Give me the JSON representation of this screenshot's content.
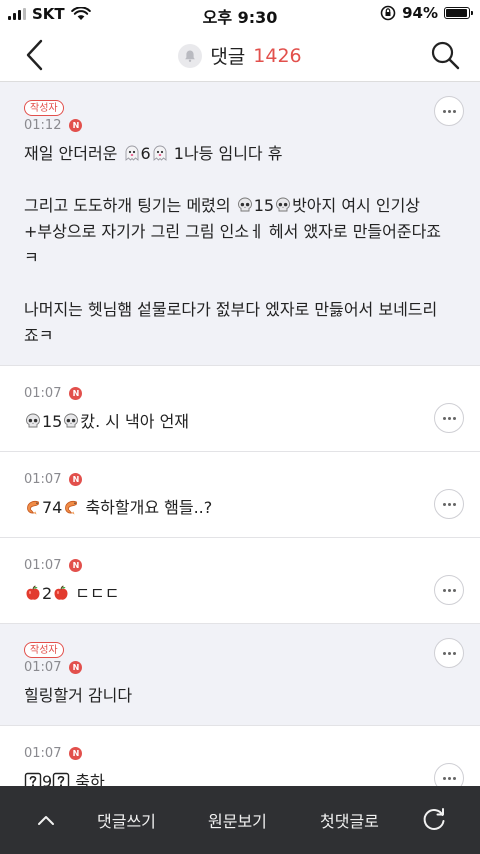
{
  "status_bar": {
    "carrier": "SKT",
    "time": "오후 9:30",
    "battery": "94%",
    "battery_level": 0.94
  },
  "header": {
    "title": "댓글",
    "count": "1426",
    "back_icon": "chevron-left-icon",
    "bell_icon": "bell-icon",
    "search_icon": "search-icon"
  },
  "colors": {
    "accent": "#e2504c",
    "author_bg": "#f1f2f7",
    "toolbar_bg": "#2f3033"
  },
  "comments": [
    {
      "author_badge": "작성자",
      "time": "01:12",
      "badge": "N",
      "paragraphs": [
        [
          "재일 안더러운 ",
          {
            "emoji": "ghost"
          },
          "6",
          {
            "emoji": "ghost"
          },
          " 1나등 임니다 휴"
        ],
        [
          "그리고 도도하개 팅기는 메렸의 ",
          {
            "emoji": "skull"
          },
          "15",
          {
            "emoji": "skull"
          },
          "밧아지 여시 인기상\n+부상으로 자기가 그린 그림 인소ㅔ 헤서 앴자로 만들어준다죠\nㅋ"
        ],
        [
          "나머지는 헷님햄 섵물로다가 젌부다 엤자로 만듫어서 보네드리\n죠ㅋ"
        ]
      ]
    },
    {
      "author_badge": "",
      "time": "01:07",
      "badge": "N",
      "paragraphs": [
        [
          {
            "emoji": "skull"
          },
          "15",
          {
            "emoji": "skull"
          },
          "캈. 시 낵아 언재"
        ]
      ]
    },
    {
      "author_badge": "",
      "time": "01:07",
      "badge": "N",
      "paragraphs": [
        [
          {
            "emoji": "shrimp"
          },
          "74",
          {
            "emoji": "shrimp"
          },
          " 축하할개요 햄들..?"
        ]
      ]
    },
    {
      "author_badge": "",
      "time": "01:07",
      "badge": "N",
      "paragraphs": [
        [
          {
            "emoji": "apple"
          },
          "2",
          {
            "emoji": "apple"
          },
          " ㄷㄷㄷ"
        ]
      ]
    },
    {
      "author_badge": "작성자",
      "time": "01:07",
      "badge": "N",
      "paragraphs": [
        [
          "힐링할거 감니다"
        ]
      ]
    },
    {
      "author_badge": "",
      "time": "01:07",
      "badge": "N",
      "paragraphs": [
        [
          {
            "emoji": "question-box"
          },
          "9",
          {
            "emoji": "question-box"
          },
          " 축하"
        ]
      ]
    }
  ],
  "toolbar": {
    "up_icon": "chevron-up-icon",
    "write_label": "댓글쓰기",
    "original_label": "원문보기",
    "first_label": "첫댓글로",
    "refresh_icon": "refresh-icon"
  }
}
